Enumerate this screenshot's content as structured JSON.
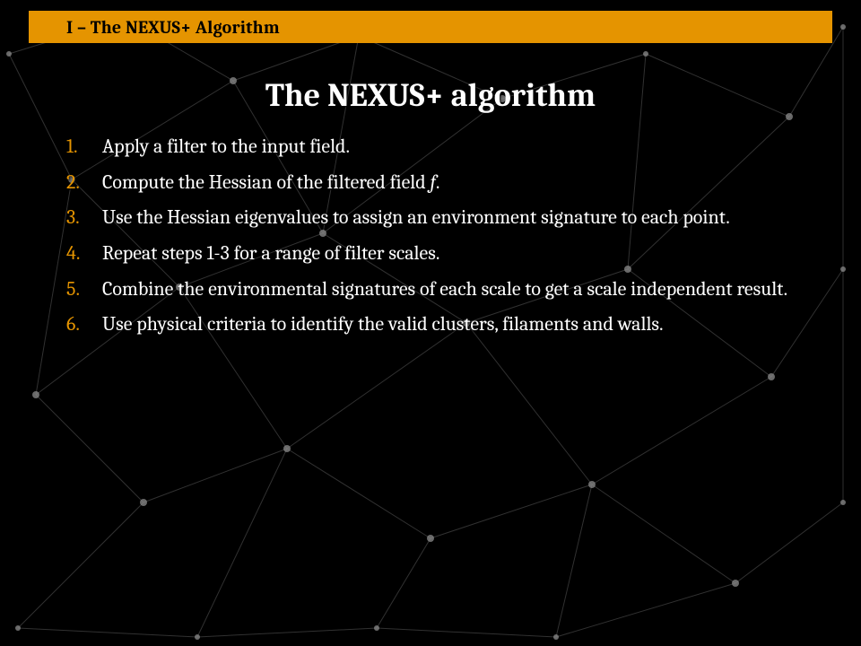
{
  "header": {
    "section_label": "I – The NEXUS+ Algorithm"
  },
  "main": {
    "title": "The NEXUS+ algorithm",
    "steps": [
      {
        "before": "Apply a filter to the input field.",
        "italic": "",
        "after": ""
      },
      {
        "before": "Compute the Hessian of the filtered field ",
        "italic": "f",
        "after": "."
      },
      {
        "before": "Use the Hessian eigenvalues to assign an environment signature to each point.",
        "italic": "",
        "after": ""
      },
      {
        "before": "Repeat steps 1-3 for a range of filter scales.",
        "italic": "",
        "after": ""
      },
      {
        "before": "Combine the environmental signatures of each scale to get a scale independent result.",
        "italic": "",
        "after": ""
      },
      {
        "before": "Use physical criteria to identify the valid clusters, filaments and walls.",
        "italic": "",
        "after": ""
      }
    ]
  },
  "colors": {
    "accent": "#e59400",
    "background": "#000000",
    "text": "#ffffff"
  }
}
